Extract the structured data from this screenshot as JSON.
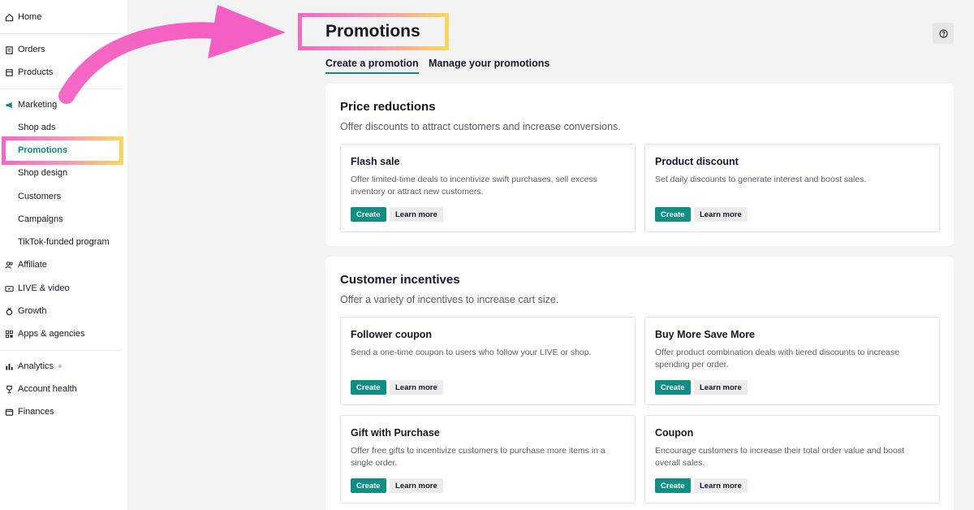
{
  "sidebar": {
    "items": [
      {
        "label": "Home",
        "icon": "home-icon"
      },
      {
        "label": "Orders",
        "icon": "clipboard-icon"
      },
      {
        "label": "Products",
        "icon": "box-icon"
      },
      {
        "label": "Marketing",
        "icon": "megaphone-icon"
      },
      {
        "label": "Shop ads"
      },
      {
        "label": "Promotions"
      },
      {
        "label": "Shop design"
      },
      {
        "label": "Customers"
      },
      {
        "label": "Campaigns"
      },
      {
        "label": "TikTok-funded program"
      },
      {
        "label": "Affiliate",
        "icon": "people-icon"
      },
      {
        "label": "LIVE & video",
        "icon": "video-icon"
      },
      {
        "label": "Growth",
        "icon": "medal-icon"
      },
      {
        "label": "Apps & agencies",
        "icon": "grid-icon"
      },
      {
        "label": "Analytics",
        "icon": "bar-chart-icon"
      },
      {
        "label": "Account health",
        "icon": "trophy-icon"
      },
      {
        "label": "Finances",
        "icon": "wallet-icon"
      }
    ]
  },
  "header": {
    "title": "Promotions",
    "help_icon": "help-circle-icon"
  },
  "tabs": [
    {
      "label": "Create a promotion",
      "active": true
    },
    {
      "label": "Manage your promotions",
      "active": false
    }
  ],
  "sections": [
    {
      "title": "Price reductions",
      "description": "Offer discounts to attract customers and increase conversions.",
      "cards": [
        {
          "title": "Flash sale",
          "description": "Offer limited-time deals to incentivize swift purchases, sell excess inventory or attract new customers.",
          "create": "Create",
          "learn": "Learn more"
        },
        {
          "title": "Product discount",
          "description": "Set daily discounts to generate interest and boost sales.",
          "create": "Create",
          "learn": "Learn more"
        }
      ]
    },
    {
      "title": "Customer incentives",
      "description": "Offer a variety of incentives to increase cart size.",
      "cards": [
        {
          "title": "Follower coupon",
          "description": "Send a one-time coupon to users who follow your LIVE or shop.",
          "create": "Create",
          "learn": "Learn more"
        },
        {
          "title": "Buy More Save More",
          "description": "Offer product combination deals with tiered discounts to increase spending per order.",
          "create": "Create",
          "learn": "Learn more"
        },
        {
          "title": "Gift with Purchase",
          "description": "Offer free gifts to incentivize customers to purchase more items in a single order.",
          "create": "Create",
          "learn": "Learn more"
        },
        {
          "title": "Coupon",
          "description": "Encourage customers to increase their total order value and boost overall sales.",
          "create": "Create",
          "learn": "Learn more"
        }
      ]
    }
  ],
  "colors": {
    "accent": "#0f8f84",
    "highlight_pink": "#f468c5",
    "highlight_yellow": "#f6d75f",
    "background": "#f3f3f3"
  }
}
